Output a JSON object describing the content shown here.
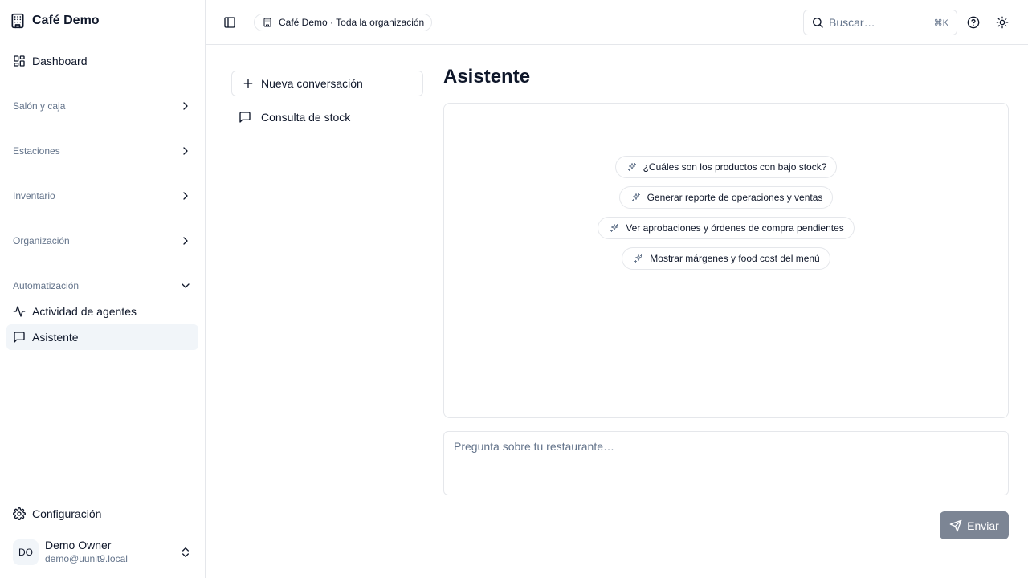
{
  "sidebar": {
    "brand": "Café Demo",
    "dashboard": "Dashboard",
    "sections": [
      {
        "label": "Salón y caja",
        "expanded": false
      },
      {
        "label": "Estaciones",
        "expanded": false
      },
      {
        "label": "Inventario",
        "expanded": false
      },
      {
        "label": "Organización",
        "expanded": false
      },
      {
        "label": "Automatización",
        "expanded": true
      }
    ],
    "automation_items": [
      {
        "label": "Actividad de agentes",
        "icon": "activity-icon"
      },
      {
        "label": "Asistente",
        "icon": "message-square-icon",
        "active": true
      }
    ],
    "settings": "Configuración",
    "user": {
      "initials": "DO",
      "name": "Demo Owner",
      "email": "demo@uunit9.local"
    }
  },
  "header": {
    "org_label": "Café Demo · Toda la organización",
    "search_placeholder": "Buscar…",
    "search_shortcut": "⌘K"
  },
  "conversations": {
    "new_label": "Nueva conversación",
    "items": [
      {
        "label": "Consulta de stock"
      }
    ]
  },
  "main": {
    "title": "Asistente",
    "suggestions": [
      "¿Cuáles son los productos con bajo stock?",
      "Generar reporte de operaciones y ventas",
      "Ver aprobaciones y órdenes de compra pendientes",
      "Mostrar márgenes y food cost del menú"
    ],
    "prompt_placeholder": "Pregunta sobre tu restaurante…",
    "send_label": "Enviar"
  },
  "colors": {
    "send_button_bg": "#7c8594",
    "active_item_bg": "#f1f5f9",
    "border": "#e5e7eb",
    "muted_text": "#64748b"
  }
}
